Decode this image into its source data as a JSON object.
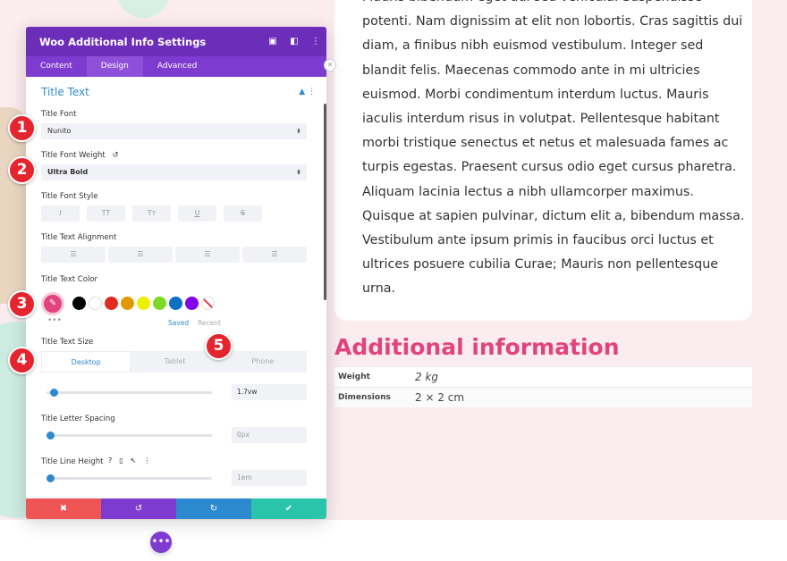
{
  "body_text": [
    "Mauris bibendum eget dui sed vehicula. Suspendisse",
    "potenti. Nam dignissim at elit non lobortis. Cras sagittis dui",
    "diam, a finibus nibh euismod vestibulum. Integer sed",
    "blandit felis. Maecenas commodo ante in mi ultricies",
    "euismod. Morbi condimentum interdum luctus. Mauris",
    "iaculis interdum risus in volutpat. Pellentesque habitant",
    "morbi tristique senectus et netus et malesuada fames ac",
    "turpis egestas. Praesent cursus odio eget cursus pharetra.",
    "Aliquam lacinia lectus a nibh ullamcorper maximus.",
    "Quisque at sapien pulvinar, dictum elit a, bibendum massa.",
    "Vestibulum ante ipsum primis in faucibus orci luctus et",
    "ultrices posuere cubilia Curae; Mauris non pellentesque",
    "urna."
  ],
  "additional_info": {
    "title": "Additional information",
    "rows": [
      {
        "key": "Weight",
        "value": "2 kg"
      },
      {
        "key": "Dimensions",
        "value": "2 × 2 cm"
      }
    ]
  },
  "panel": {
    "title": "Woo Additional Info Settings",
    "header_icons": [
      "▣",
      "◧",
      "⋮"
    ],
    "tabs": [
      "Content",
      "Design",
      "Advanced"
    ],
    "active_tab": "Design",
    "section_title": "Title Text",
    "section_ctrls": "▲ ⋮",
    "title_font": {
      "label": "Title Font",
      "value": "Nunito",
      "arrow": "⬍"
    },
    "title_font_weight": {
      "label": "Title Font Weight",
      "reset_icon": "↺",
      "value": "Ultra Bold",
      "arrow": "⬍"
    },
    "title_font_style": {
      "label": "Title Font Style",
      "buttons": [
        "I",
        "TT",
        "Tт",
        "U",
        "S"
      ]
    },
    "title_text_alignment": {
      "label": "Title Text Alignment",
      "buttons": [
        "☰",
        "☰",
        "☰",
        "☰"
      ]
    },
    "title_text_color": {
      "label": "Title Text Color",
      "picker_icon": "✎",
      "selected": "#e2437d",
      "swatches": [
        "#000000",
        "#ffffff",
        "#e02b20",
        "#e09900",
        "#edf000",
        "#7cda24",
        "#0c71c3",
        "#8300e9"
      ],
      "dots": "•••",
      "saved": "Saved",
      "recent": "Recent"
    },
    "title_text_size": {
      "label": "Title Text Size",
      "devices": [
        "Desktop",
        "Tablet",
        "Phone"
      ],
      "active_device": "Desktop",
      "value": "1.7vw",
      "slider_fraction": 0.02
    },
    "title_letter_spacing": {
      "label": "Title Letter Spacing",
      "value": "0px",
      "slider_fraction": 0.0
    },
    "title_line_height": {
      "label": "Title Line Height",
      "icons": [
        "?",
        "▯",
        "↖",
        "⋮"
      ],
      "value": "1em",
      "slider_fraction": 0.0
    },
    "footer": {
      "discard": "✖",
      "undo": "↺",
      "redo": "↻",
      "save": "✔"
    }
  },
  "callouts": [
    "1",
    "2",
    "3",
    "4",
    "5"
  ],
  "close_icon": "✕",
  "fab_icon": "•••"
}
